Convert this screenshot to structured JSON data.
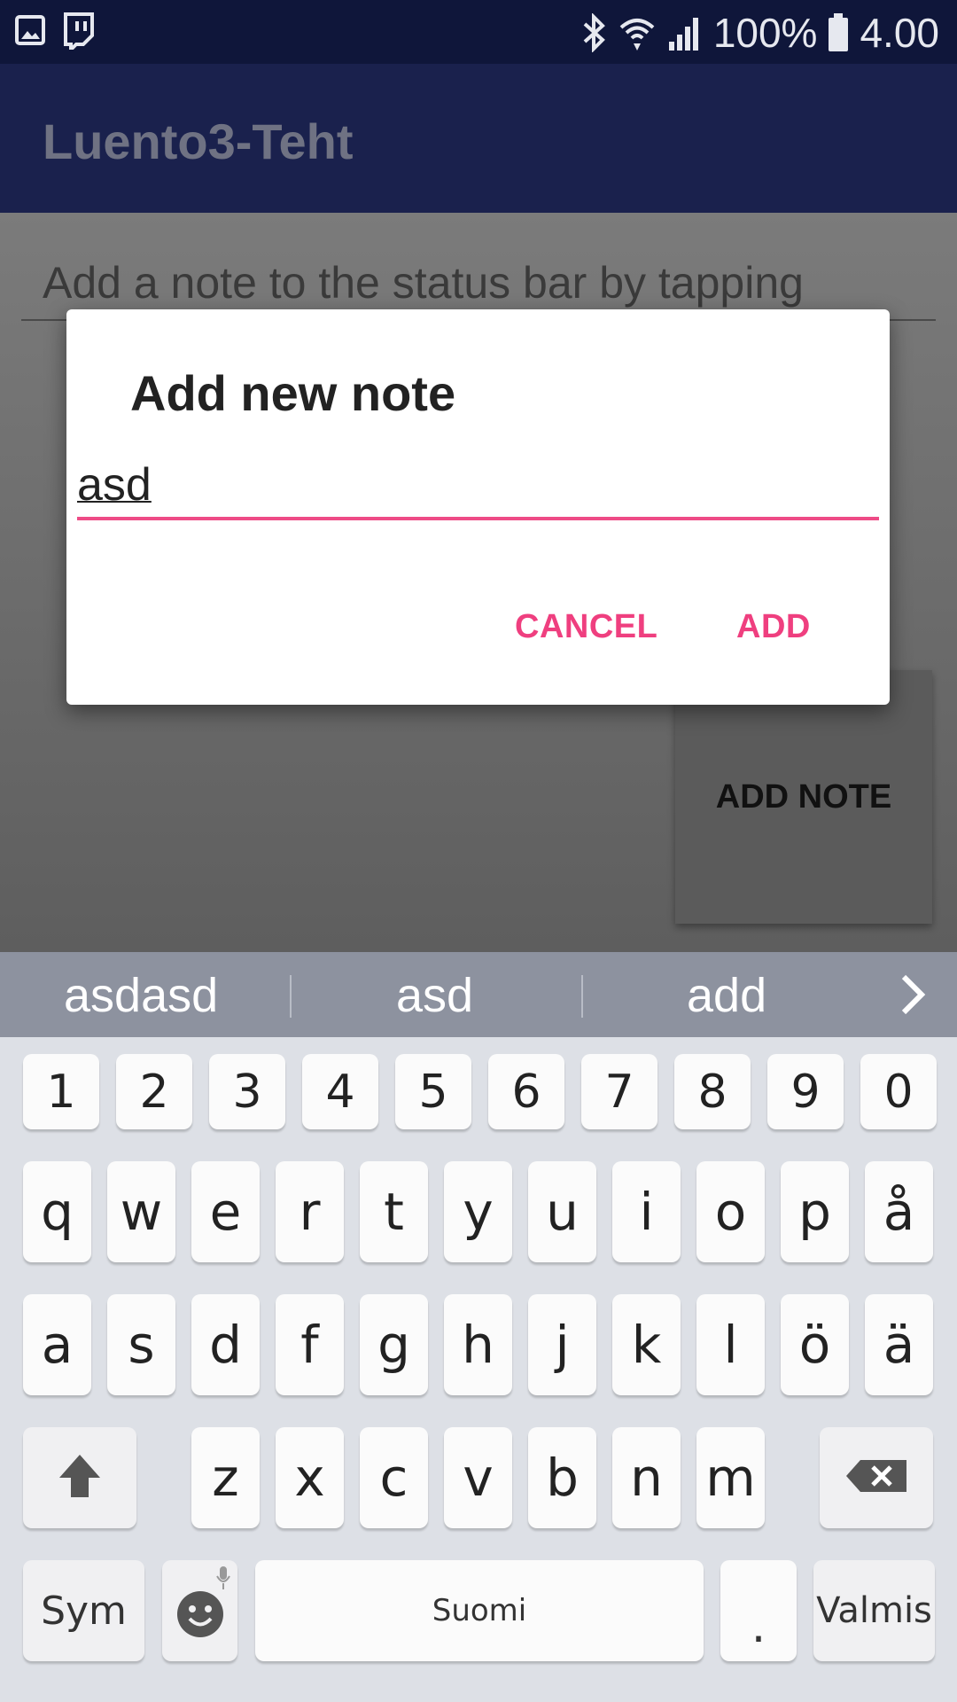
{
  "status_bar": {
    "battery_percent": "100%",
    "time": "4.00",
    "icons": [
      "gallery-icon",
      "twitch-icon",
      "bluetooth-icon",
      "wifi-icon",
      "signal-icon",
      "battery-icon"
    ]
  },
  "app": {
    "title": "Luento3-Teht",
    "hint": "Add a note to the status bar by tapping",
    "add_note_button": "ADD NOTE"
  },
  "dialog": {
    "title": "Add new note",
    "input_value": "asd",
    "cancel_label": "CANCEL",
    "add_label": "ADD",
    "accent_color": "#ee4b86"
  },
  "keyboard": {
    "suggestions": [
      "asdasd",
      "asd",
      "add"
    ],
    "number_row": [
      "1",
      "2",
      "3",
      "4",
      "5",
      "6",
      "7",
      "8",
      "9",
      "0"
    ],
    "row1": [
      "q",
      "w",
      "e",
      "r",
      "t",
      "y",
      "u",
      "i",
      "o",
      "p",
      "å"
    ],
    "row2": [
      "a",
      "s",
      "d",
      "f",
      "g",
      "h",
      "j",
      "k",
      "l",
      "ö",
      "ä"
    ],
    "row3": [
      "z",
      "x",
      "c",
      "v",
      "b",
      "n",
      "m"
    ],
    "sym_label": "Sym",
    "space_label": "Suomi",
    "period_label": ".",
    "done_label": "Valmis"
  }
}
